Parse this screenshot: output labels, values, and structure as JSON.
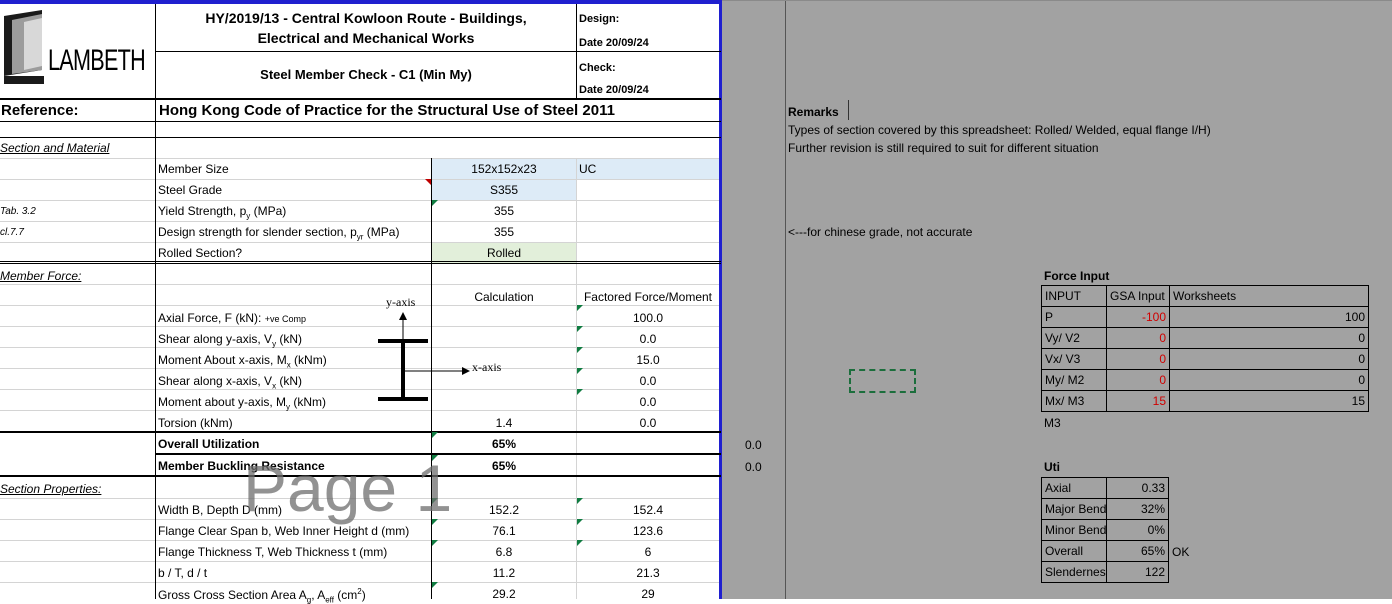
{
  "header": {
    "logo_text": "LAMBETH",
    "project_line1": "HY/2019/13 - Central Kowloon Route - Buildings,",
    "project_line2": "Electrical and Mechanical Works",
    "sheet_title": "Steel Member Check - C1 (Min My)",
    "design_label": "Design:",
    "design_date": "Date  20/09/24",
    "check_label": "Check:",
    "check_date": "Date  20/09/24",
    "reference_label": "Reference:",
    "reference_value": "Hong Kong Code of Practice for the Structural Use of Steel 2011"
  },
  "sections": {
    "section_material": "Section and Material",
    "member_force": "Member Force:",
    "section_properties": "Section Properties:"
  },
  "material": {
    "member_size_label": "Member Size",
    "member_size": "152x152x23",
    "member_type": "UC",
    "steel_grade_label": "Steel Grade",
    "steel_grade": "S355",
    "yield_ref": "Tab. 3.2",
    "yield_label": "Yield Strength, p",
    "yield_sub": "y",
    "yield_unit": " (MPa)",
    "yield_value": "355",
    "design_ref": "cl.7.7",
    "design_label": "Design strength for slender section, p",
    "design_sub": "yr",
    "design_unit": " (MPa)",
    "design_value": "355",
    "rolled_label": "Rolled Section?",
    "rolled_value": "Rolled"
  },
  "forces": {
    "col_calc": "Calculation",
    "col_factored": "Factored Force/Moment",
    "axial_label": "Axial Force, F (kN): ",
    "axial_note": "+ve Comp",
    "axial_value": "100.0",
    "shear_y_label": "Shear along y-axis, V",
    "shear_y_sub": "y",
    "shear_y_unit": " (kN)",
    "shear_y_value": "0.0",
    "moment_x_label": "Moment About x-axis, M",
    "moment_x_sub": "x",
    "moment_x_unit": " (kNm)",
    "moment_x_value": "15.0",
    "shear_x_label": "Shear along x-axis, V",
    "shear_x_sub": "x",
    "shear_x_unit": " (kN)",
    "shear_x_value": "0.0",
    "moment_y_label": "Moment about y-axis, M",
    "moment_y_sub": "y",
    "moment_y_unit": " (kNm)",
    "moment_y_value": "0.0",
    "torsion_label": "Torsion (kNm)",
    "torsion_calc": "1.4",
    "torsion_value": "0.0",
    "y_axis_label": "y-axis",
    "x_axis_label": "x-axis"
  },
  "utilization": {
    "overall_label": "Overall Utilization",
    "overall_value": "65%",
    "buckling_label": "Member Buckling Resistance",
    "buckling_value": "65%",
    "side_value_1": "0.0",
    "side_value_2": "0.0"
  },
  "page_watermark": "Page 1",
  "properties": [
    {
      "label": "Width B, Depth D (mm)",
      "v1": "152.2",
      "v2": "152.4"
    },
    {
      "label": "Flange Clear Span b, Web Inner Height d (mm)",
      "v1": "76.1",
      "v2": "123.6"
    },
    {
      "label": "Flange Thickness T, Web Thickness t (mm)",
      "v1": "6.8",
      "v2": "6"
    },
    {
      "label": "b / T, d / t",
      "v1": "11.2",
      "v2": "21.3"
    }
  ],
  "gross_area": {
    "label": "Gross Cross Section Area A",
    "sub1": "g",
    "sep": ", A",
    "sub2": "eff",
    "unit": " (cm",
    "sup": "2",
    "close": ")",
    "v1": "29.2",
    "v2": "29"
  },
  "remarks": {
    "title": "Remarks",
    "line1": "Types of section covered by this spreadsheet: Rolled/ Welded, equal flange I/H)",
    "line2": "Further revision is still required to suit for different situation",
    "grade_note": "<---for chinese grade, not accurate"
  },
  "force_input": {
    "title": "Force Input",
    "headers": [
      "INPUT",
      "GSA Input",
      "Worksheets"
    ],
    "rows": [
      {
        "name": "P",
        "gsa": "-100",
        "ws": "100"
      },
      {
        "name": "Vy/ V2",
        "gsa": "0",
        "ws": "0"
      },
      {
        "name": "Vx/ V3",
        "gsa": "0",
        "ws": "0"
      },
      {
        "name": "My/ M2",
        "gsa": "0",
        "ws": "0"
      },
      {
        "name": "Mx/ M3",
        "gsa": "15",
        "ws": "15"
      }
    ],
    "note": "M3"
  },
  "uti": {
    "title": "Uti",
    "rows": [
      {
        "name": "Axial",
        "value": "0.33",
        "flag": ""
      },
      {
        "name": "Major Bend",
        "value": "32%",
        "flag": ""
      },
      {
        "name": "Minor Bend",
        "value": "0%",
        "flag": ""
      },
      {
        "name": "Overall",
        "value": "65%",
        "flag": "OK"
      },
      {
        "name": "Slendernes",
        "value": "122",
        "flag": ""
      }
    ]
  },
  "colors": {
    "input_blue": "#ddebf7",
    "input_green": "#e2efda",
    "sheet_grey": "#a2a2a2",
    "border_blue": "#1f1fcf",
    "red_value": "#d00000"
  }
}
